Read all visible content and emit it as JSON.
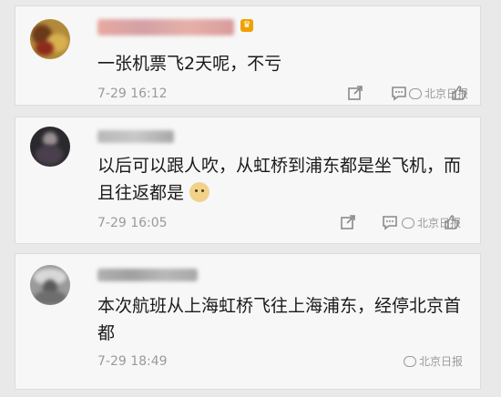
{
  "comments": [
    {
      "text": "一张机票飞2天呢，不亏",
      "time": "7-29 16:12",
      "watermark": "北京日报",
      "has_badge": true
    },
    {
      "text": "以后可以跟人吹，从虹桥到浦东都是坐飞机，而且往返都是",
      "time": "7-29 16:05",
      "watermark": "北京日报",
      "emoji": "doge-emoji"
    },
    {
      "text": "本次航班从上海虹桥飞往上海浦东，经停北京首都",
      "time": "7-29 18:49",
      "watermark": "北京日报"
    }
  ],
  "icons": {
    "share": "share-icon",
    "comment": "comment-icon",
    "like": "like-icon"
  },
  "colors": {
    "background": "#e9e9e9",
    "card": "#f7f7f7",
    "text": "#1a1a1a",
    "meta": "#9a9a9a"
  }
}
